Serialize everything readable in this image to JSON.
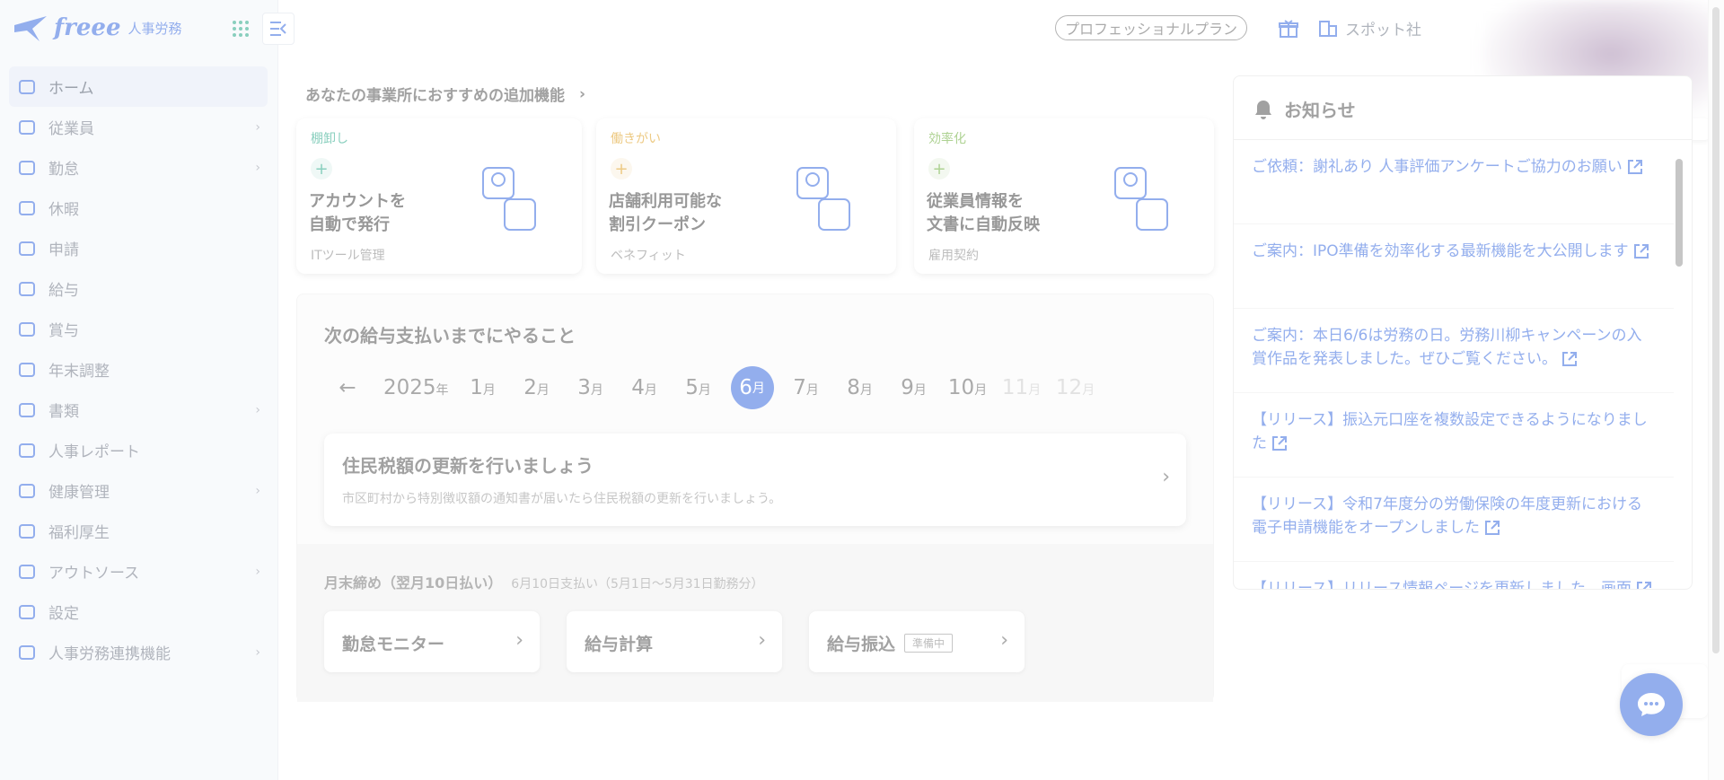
{
  "brand": {
    "logo_text": "freee",
    "product": "人事労務"
  },
  "nav": {
    "items": [
      {
        "label": "ホーム",
        "icon": "home-icon",
        "chevron": ""
      },
      {
        "label": "従業員",
        "icon": "employee-icon",
        "chevron": "›"
      },
      {
        "label": "勤怠",
        "icon": "clock-icon",
        "chevron": "›"
      },
      {
        "label": "休暇",
        "icon": "leave-icon",
        "chevron": ""
      },
      {
        "label": "申請",
        "icon": "stamp-icon",
        "chevron": ""
      },
      {
        "label": "給与",
        "icon": "card-icon",
        "chevron": ""
      },
      {
        "label": "賞与",
        "icon": "bonus-icon",
        "chevron": ""
      },
      {
        "label": "年末調整",
        "icon": "adjust-icon",
        "chevron": ""
      },
      {
        "label": "書類",
        "icon": "document-icon",
        "chevron": "›"
      },
      {
        "label": "人事レポート",
        "icon": "report-icon",
        "chevron": ""
      },
      {
        "label": "健康管理",
        "icon": "health-icon",
        "chevron": "›"
      },
      {
        "label": "福利厚生",
        "icon": "welfare-icon",
        "chevron": ""
      },
      {
        "label": "アウトソース",
        "icon": "outsource-icon",
        "chevron": "›"
      },
      {
        "label": "設定",
        "icon": "gear-icon",
        "chevron": ""
      },
      {
        "label": "人事労務連携機能",
        "icon": "link-icon",
        "chevron": "›"
      }
    ]
  },
  "topbar": {
    "plan": "プロフェッショナルプラン",
    "company": "スポット社"
  },
  "recommend": {
    "header": "あなたの事業所におすすめの追加機能",
    "cards": [
      {
        "category": "棚卸し",
        "title1": "アカウントを",
        "title2": "自動で発行",
        "sub": "ITツール管理",
        "color": "#2aa98a"
      },
      {
        "category": "働きがい",
        "title1": "店舗利用可能な",
        "title2": "割引クーポン",
        "sub": "ベネフィット",
        "color": "#e0a020"
      },
      {
        "category": "効率化",
        "title1": "従業員情報を",
        "title2": "文書に自動反映",
        "sub": "雇用契約",
        "color": "#6cae3a"
      }
    ]
  },
  "todo": {
    "title": "次の給与支払いまでにやること",
    "year": "2025",
    "year_suffix": "年",
    "month_suffix": "月",
    "months": [
      "1",
      "2",
      "3",
      "4",
      "5",
      "6",
      "7",
      "8",
      "9",
      "10",
      "11",
      "12"
    ],
    "active_month": "6",
    "task_title": "住民税額の更新を行いましょう",
    "task_desc": "市区町村から特別徴収額の通知書が届いたら住民税額の更新を行いましょう。",
    "closing_title": "月末締め（翌月10日払い）",
    "closing_sub": "6月10日支払い（5月1日〜5月31日勤務分）",
    "steps": [
      {
        "label": "勤怠モニター",
        "tag": ""
      },
      {
        "label": "給与計算",
        "tag": ""
      },
      {
        "label": "給与振込",
        "tag": "準備中"
      }
    ]
  },
  "news": {
    "title": "お知らせ",
    "items": [
      "ご依頼：謝礼あり 人事評価アンケートご協力のお願い",
      "ご案内：IPO準備を効率化する最新機能を大公開します",
      "ご案内：本日6/6は労務の日。労務川柳キャンペーンの入賞作品を発表しました。ぜひご覧ください。",
      "【リリース】振込元口座を複数設定できるようになりました",
      "【リリース】令和7年度分の労働保険の年度更新における電子申請機能をオープンしました",
      "【リリース】リリース情報ページを更新しました。画面"
    ]
  },
  "colors": {
    "accent": "#3b6ce0",
    "sidebar_bg": "#f4f6fb"
  }
}
